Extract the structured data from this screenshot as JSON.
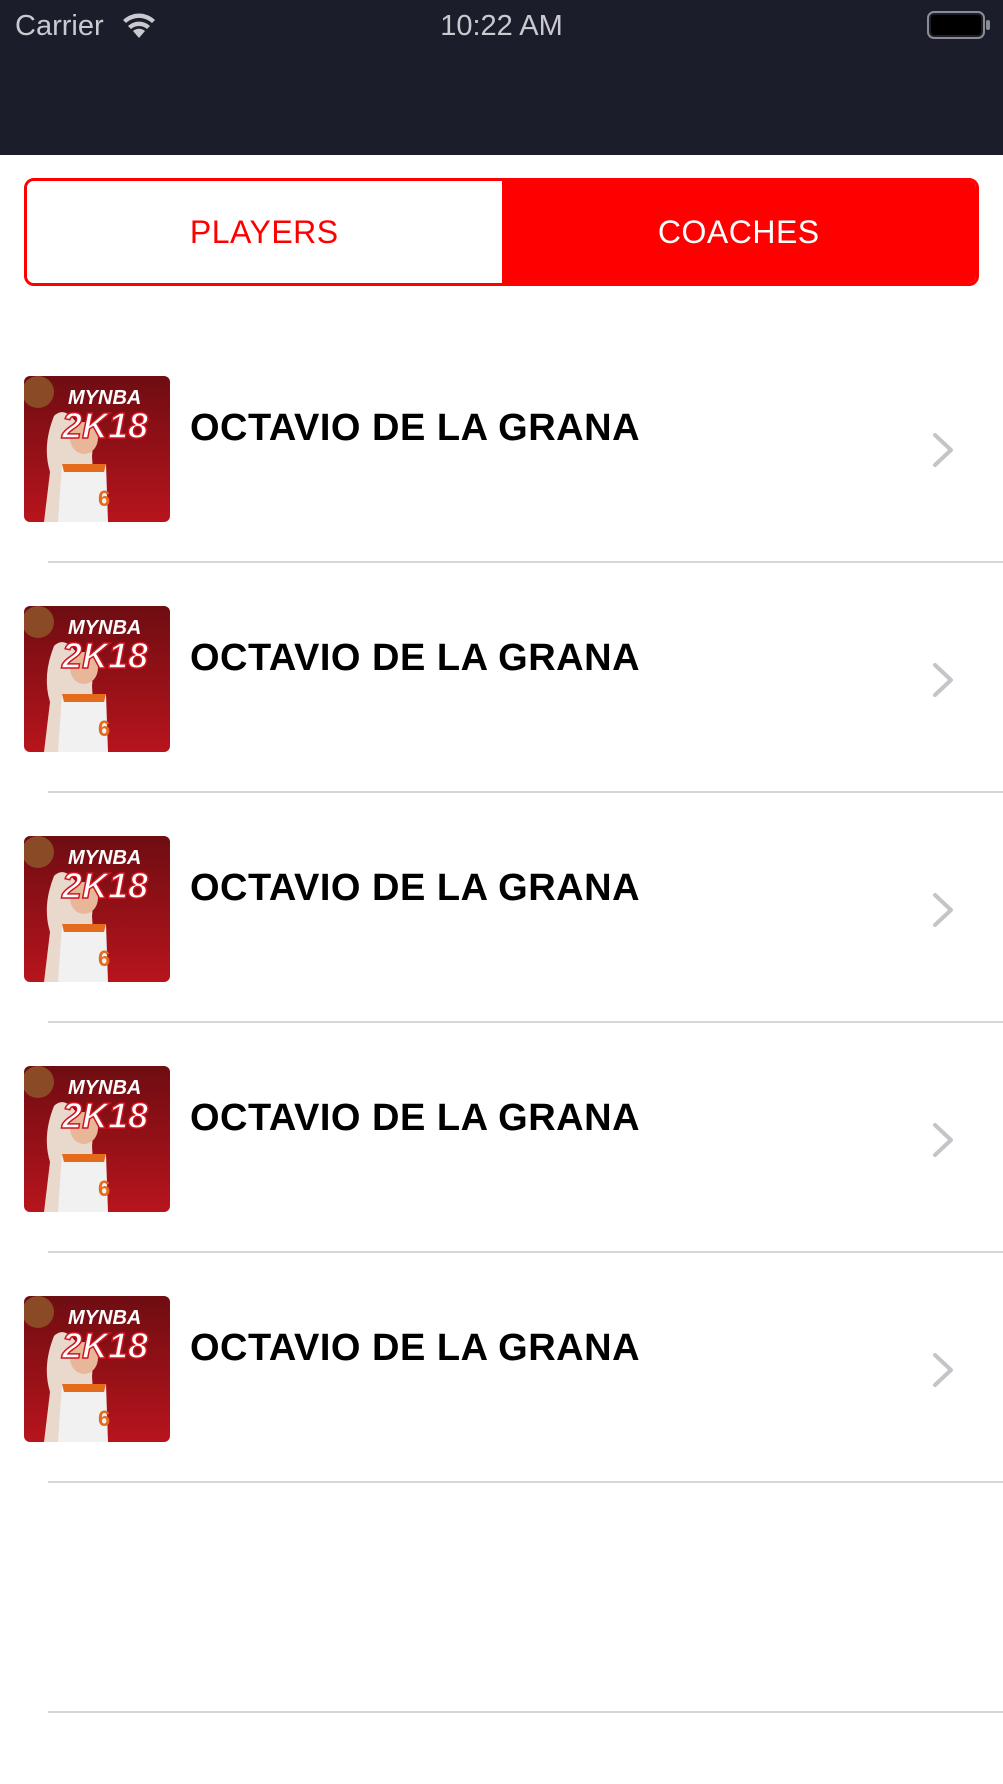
{
  "status_bar": {
    "carrier": "Carrier",
    "time": "10:22 AM",
    "wifi_icon": "wifi-icon",
    "battery_icon": "battery-icon"
  },
  "segmented_control": {
    "players_label": "PLAYERS",
    "coaches_label": "COACHES",
    "selected": "COACHES",
    "accent_color": "#ff0000"
  },
  "list": {
    "items": [
      {
        "name": "OCTAVIO DE LA GRANA",
        "thumbnail": "mynba-2k18-cover-image",
        "thumbnail_text": "MYNBA 2K18"
      },
      {
        "name": "OCTAVIO DE LA GRANA",
        "thumbnail": "mynba-2k18-cover-image",
        "thumbnail_text": "MYNBA 2K18"
      },
      {
        "name": "OCTAVIO DE LA GRANA",
        "thumbnail": "mynba-2k18-cover-image",
        "thumbnail_text": "MYNBA 2K18"
      },
      {
        "name": "OCTAVIO DE LA GRANA",
        "thumbnail": "mynba-2k18-cover-image",
        "thumbnail_text": "MYNBA 2K18"
      },
      {
        "name": "OCTAVIO DE LA GRANA",
        "thumbnail": "mynba-2k18-cover-image",
        "thumbnail_text": "MYNBA 2K18"
      }
    ]
  },
  "colors": {
    "header_background": "#1b1e2a",
    "separator": "#d6d6d9",
    "chevron": "#c4c4c9"
  }
}
